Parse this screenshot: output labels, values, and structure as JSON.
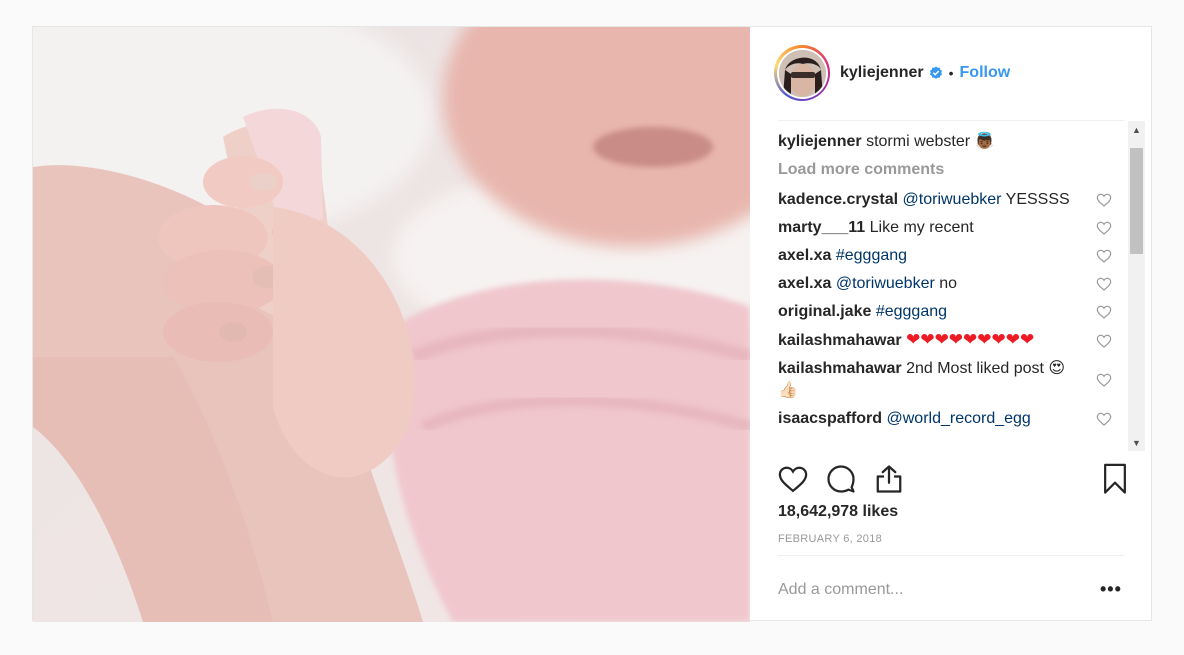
{
  "post": {
    "username": "kyliejenner",
    "follow_label": "Follow",
    "separator": "•",
    "caption": {
      "user": "kyliejenner",
      "text": "stormi webster 👼🏾"
    },
    "load_more_label": "Load more comments",
    "comments": [
      {
        "user": "kadence.crystal",
        "text_mention": "@toriwuebker",
        "text_rest": " YESSSS"
      },
      {
        "user": "marty___11",
        "text_mention": "",
        "text_rest": "Like my recent"
      },
      {
        "user": "axel.xa",
        "text_mention": "#egggang",
        "text_rest": ""
      },
      {
        "user": "axel.xa",
        "text_mention": "@toriwuebker",
        "text_rest": " no"
      },
      {
        "user": "original.jake",
        "text_mention": "#egggang",
        "text_rest": ""
      },
      {
        "user": "kailashmahawar",
        "text_mention": "",
        "text_rest": "❤❤❤❤❤❤❤❤❤"
      },
      {
        "user": "kailashmahawar",
        "text_mention": "",
        "text_rest": "2nd Most liked post 😍👍🏻"
      },
      {
        "user": "isaacspafford",
        "text_mention": "@world_record_egg",
        "text_rest": ""
      }
    ],
    "likes": "18,642,978 likes",
    "date": "FEBRUARY 6, 2018",
    "add_comment_placeholder": "Add a comment...",
    "more_label": "•••"
  },
  "colors": {
    "accent": "#3897f0",
    "mention": "#003569",
    "muted": "#999999"
  },
  "icons": [
    "verified-badge-icon",
    "heart-icon",
    "comment-icon",
    "share-icon",
    "bookmark-icon",
    "scroll-up-icon",
    "scroll-down-icon"
  ]
}
